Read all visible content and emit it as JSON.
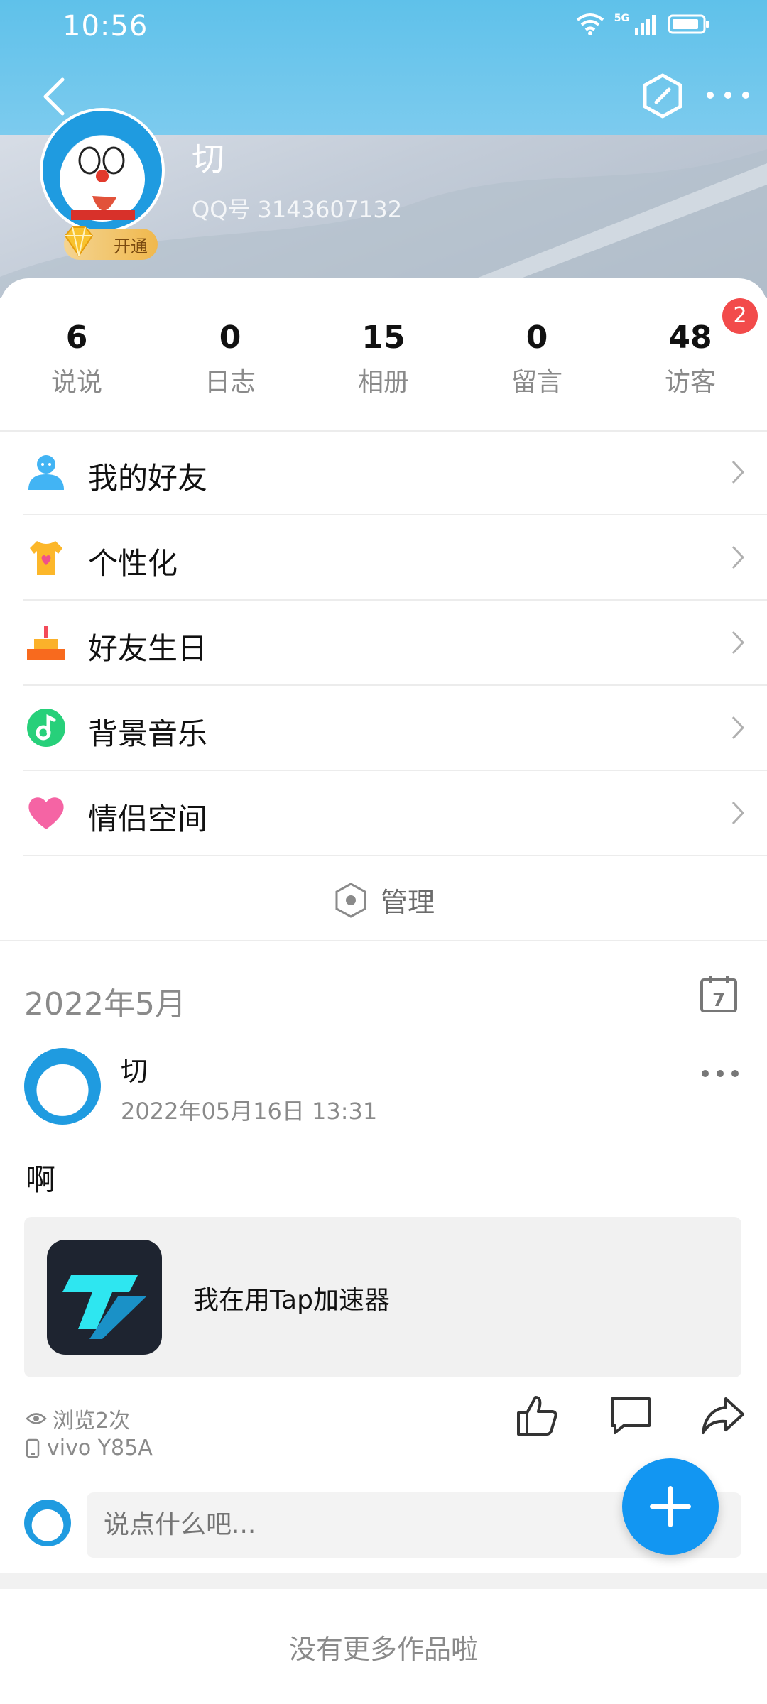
{
  "status_bar": {
    "time": "10:56",
    "network": "5G"
  },
  "profile": {
    "name": "切",
    "qq_number": "QQ号 3143607132",
    "vip_label": "开通"
  },
  "stats": [
    {
      "value": "6",
      "label": "说说"
    },
    {
      "value": "0",
      "label": "日志"
    },
    {
      "value": "15",
      "label": "相册"
    },
    {
      "value": "0",
      "label": "留言"
    },
    {
      "value": "48",
      "label": "访客"
    }
  ],
  "visitor_badge": "2",
  "menu": [
    {
      "label": "我的好友",
      "icon": "friends-icon"
    },
    {
      "label": "个性化",
      "icon": "tshirt-icon"
    },
    {
      "label": "好友生日",
      "icon": "cake-icon"
    },
    {
      "label": "背景音乐",
      "icon": "music-icon"
    },
    {
      "label": "情侣空间",
      "icon": "heart-icon"
    }
  ],
  "manage_label": "管理",
  "feed": {
    "month": "2022年5月",
    "calendar_day": "7",
    "post": {
      "author": "切",
      "time": "2022年05月16日 13:31",
      "text": "啊",
      "share_text": "我在用Tap加速器",
      "views": "浏览2次",
      "device": "vivo Y85A"
    },
    "comment_placeholder": "说点什么吧...",
    "end_text": "没有更多作品啦"
  },
  "colors": {
    "accent": "#1296f2",
    "badge": "#f24b4b",
    "header": "#6cc7ec"
  }
}
